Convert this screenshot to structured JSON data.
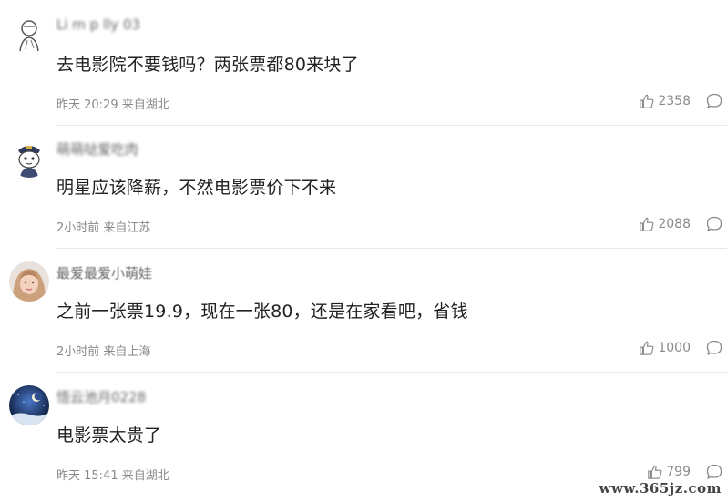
{
  "comments": [
    {
      "username": "Li m p  lly 03",
      "avatar": "sketch-avatar-icon",
      "content": "去电影院不要钱吗？两张票都80来块了",
      "time": "昨天 20:29",
      "location": "来自湖北",
      "likes": "2358"
    },
    {
      "username": "萌萌哒爱吃肉",
      "avatar": "police-cartoon-avatar-icon",
      "content": "明星应该降薪，不然电影票价下不来",
      "time": "2小时前",
      "location": "来自江苏",
      "likes": "2088"
    },
    {
      "username": "最爱最爱小萌娃",
      "avatar": "girl-photo-avatar-icon",
      "content": "之前一张票19.9，现在一张80，还是在家看吧，省钱",
      "time": "2小时前",
      "location": "来自上海",
      "likes": "1000"
    },
    {
      "username": "悟云池月0228",
      "avatar": "night-sky-avatar-icon",
      "content": "电影票太贵了",
      "time": "昨天 15:41",
      "location": "来自湖北",
      "likes": "799"
    }
  ],
  "watermark": "www.365jz.com",
  "colors": {
    "text": "#222222",
    "meta": "#8a8a8a",
    "divider": "#e8e8e8"
  }
}
